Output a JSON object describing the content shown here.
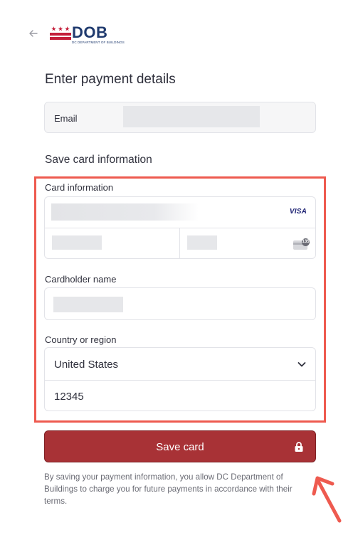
{
  "header": {
    "back_icon": "arrow-left-icon",
    "logo": {
      "wordmark": "DOB",
      "subtitle": "DC DEPARTMENT OF BUILDINGS"
    }
  },
  "page": {
    "title": "Enter payment details"
  },
  "email": {
    "label": "Email"
  },
  "section": {
    "title": "Save card information"
  },
  "card": {
    "label": "Card information",
    "brand": "VISA",
    "cvc_icon": "card-cvc-icon",
    "cvc_badge": "135"
  },
  "cardholder": {
    "label": "Cardholder name"
  },
  "country": {
    "label": "Country or region",
    "selected": "United States",
    "zip": "12345"
  },
  "actions": {
    "save_label": "Save card",
    "lock_icon": "lock-icon"
  },
  "terms": {
    "text": "By saving your payment information, you allow DC Department of Buildings to charge you for future payments in accordance with their terms."
  },
  "colors": {
    "primary_button": "#a83236",
    "highlight_box": "#ee5a4f",
    "logo_navy": "#1f3a6e",
    "logo_red": "#c41e3a"
  }
}
